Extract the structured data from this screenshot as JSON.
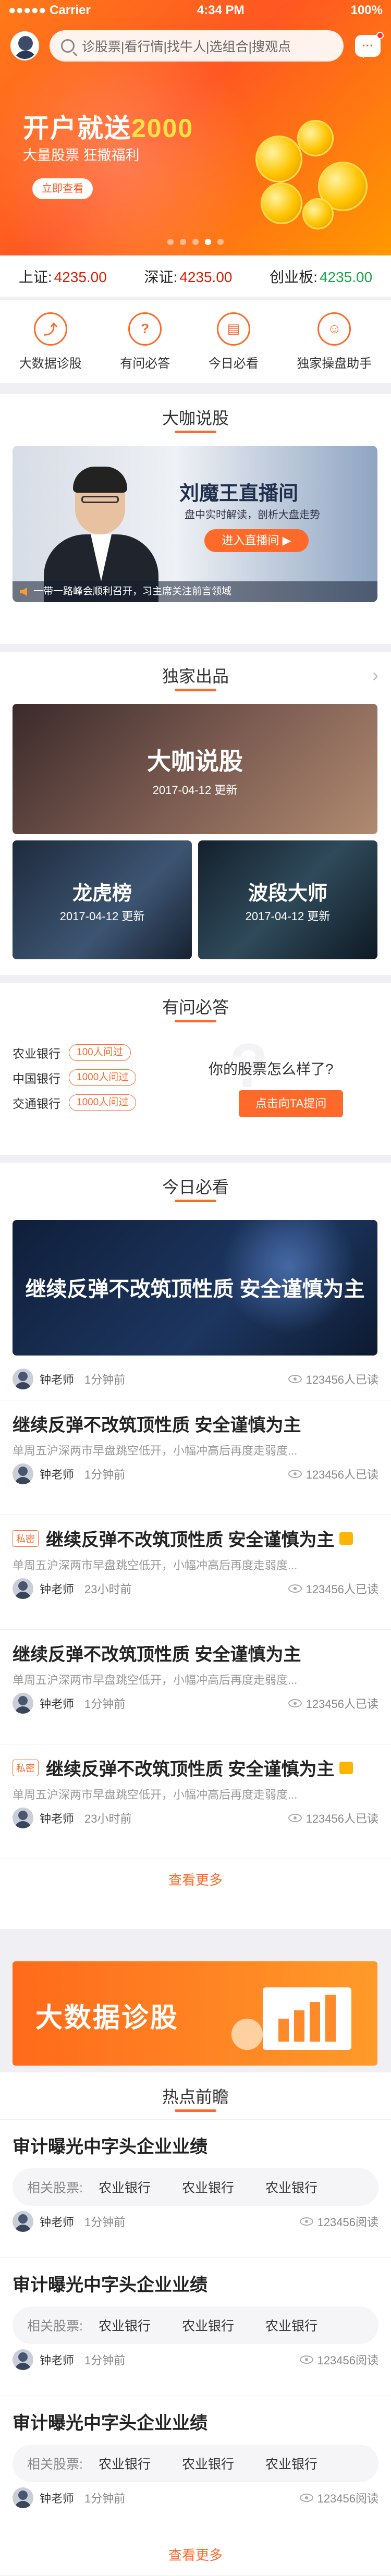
{
  "status_bar": {
    "carrier": "●●●●● Carrier",
    "time": "4:34 PM",
    "battery": "100%"
  },
  "header": {
    "search_placeholder": "诊股票|看行情|找牛人|选组合|搜观点"
  },
  "banner": {
    "title_prefix": "开户就送",
    "title_highlight": "2000",
    "subtitle": "大量股票 狂撒福利",
    "button": "立即查看"
  },
  "index_bar": [
    {
      "label": "上证:",
      "value": "4235.00",
      "color": "#d81e06"
    },
    {
      "label": "深证:",
      "value": "4235.00",
      "color": "#d81e06"
    },
    {
      "label": "创业板:",
      "value": "4235.00",
      "color": "#1aa34a"
    }
  ],
  "features": [
    {
      "label": "大数据诊股",
      "icon": "chart-icon",
      "glyph": "⤴"
    },
    {
      "label": "有问必答",
      "icon": "qa-icon",
      "glyph": "?"
    },
    {
      "label": "今日必看",
      "icon": "news-icon",
      "glyph": "▤"
    },
    {
      "label": "独家操盘助手",
      "icon": "advisor-icon",
      "glyph": "☺"
    }
  ],
  "dakashuo": {
    "title": "大咖说股",
    "live_title": "刘魔王直播间",
    "live_desc": "盘中实时解读，剖析大盘走势",
    "live_button": "进入直播间 ▶",
    "ticker": "一带一路峰会顺利召开，习主席关注前言领域"
  },
  "exclusive": {
    "title": "独家出品",
    "cards": [
      {
        "title": "大咖说股",
        "date": "2017-04-12  更新"
      },
      {
        "title": "龙虎榜",
        "date": "2017-04-12  更新"
      },
      {
        "title": "波段大师",
        "date": "2017-04-12  更新"
      }
    ]
  },
  "qa": {
    "title": "有问必答",
    "rows": [
      {
        "bank": "农业银行",
        "count": "100人问过"
      },
      {
        "bank": "中国银行",
        "count": "1000人问过"
      },
      {
        "bank": "交通银行",
        "count": "1000人问过"
      }
    ],
    "question": "你的股票怎么样了?",
    "button": "点击向TA提问"
  },
  "today": {
    "title": "今日必看",
    "hero_title": "继续反弹不改筑顶性质 安全谨慎为主",
    "hero_meta": {
      "name": "钟老师",
      "time": "1分钟前",
      "reads": "123456人已读"
    },
    "articles": [
      {
        "title": "继续反弹不改筑顶性质 安全谨慎为主",
        "summary": "单周五沪深两市早盘跳空低开，小幅冲高后再度走弱度...",
        "name": "钟老师",
        "time": "1分钟前",
        "reads": "123456人已读",
        "private": ""
      },
      {
        "title": "继续反弹不改筑顶性质 安全谨慎为主",
        "summary": "单周五沪深两市早盘跳空低开，小幅冲高后再度走弱度...",
        "name": "钟老师",
        "time": "23小时前",
        "reads": "123456人已读",
        "private": "私密"
      },
      {
        "title": "继续反弹不改筑顶性质 安全谨慎为主",
        "summary": "单周五沪深两市早盘跳空低开，小幅冲高后再度走弱度...",
        "name": "钟老师",
        "time": "1分钟前",
        "reads": "123456人已读",
        "private": ""
      },
      {
        "title": "继续反弹不改筑顶性质 安全谨慎为主",
        "summary": "单周五沪深两市早盘跳空低开，小幅冲高后再度走弱度...",
        "name": "钟老师",
        "time": "23小时前",
        "reads": "123456人已读",
        "private": "私密"
      }
    ],
    "load_more": "查看更多"
  },
  "bigdata_banner": {
    "title": "大数据诊股"
  },
  "hot": {
    "title": "热点前瞻",
    "items": [
      {
        "title": "审计曝光中字头企业业绩",
        "rel_label": "相关股票:",
        "stocks": [
          "农业银行",
          "农业银行",
          "农业银行"
        ],
        "name": "钟老师",
        "time": "1分钟前",
        "reads": "123456阅读"
      },
      {
        "title": "审计曝光中字头企业业绩",
        "rel_label": "相关股票:",
        "stocks": [
          "农业银行",
          "农业银行",
          "农业银行"
        ],
        "name": "钟老师",
        "time": "1分钟前",
        "reads": "123456阅读"
      },
      {
        "title": "审计曝光中字头企业业绩",
        "rel_label": "相关股票:",
        "stocks": [
          "农业银行",
          "农业银行",
          "农业银行"
        ],
        "name": "钟老师",
        "time": "1分钟前",
        "reads": "123456阅读"
      }
    ],
    "load_more": "查看更多"
  },
  "colors": {
    "accent": "#ff6a2a",
    "up": "#d81e06",
    "down": "#1aa34a"
  }
}
